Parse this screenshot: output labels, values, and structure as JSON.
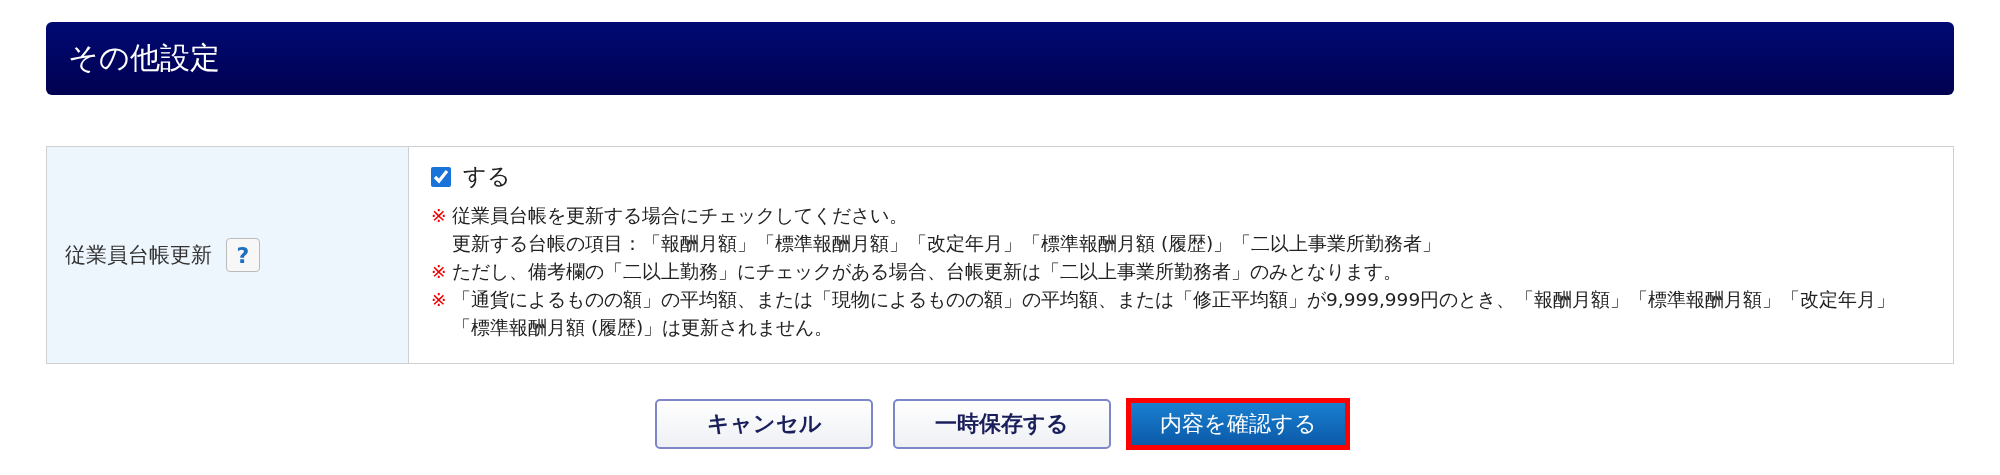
{
  "section_title": "その他設定",
  "setting": {
    "label": "従業員台帳更新",
    "help": "?",
    "checkbox": {
      "label": "する",
      "checked": true
    },
    "notes": [
      {
        "mark": "※",
        "lines": [
          "従業員台帳を更新する場合にチェックしてください。",
          "更新する台帳の項目：「報酬月額」「標準報酬月額」「改定年月」「標準報酬月額 (履歴)」「二以上事業所勤務者」"
        ]
      },
      {
        "mark": "※",
        "lines": [
          "ただし、備考欄の「二以上勤務」にチェックがある場合、台帳更新は「二以上事業所勤務者」のみとなります。"
        ]
      },
      {
        "mark": "※",
        "lines": [
          "「通貨によるものの額」の平均額、または「現物によるものの額」の平均額、または「修正平均額」が9,999,999円のとき、「報酬月額」「標準報酬月額」「改定年月」「標準報酬月額 (履歴)」は更新されません。"
        ]
      }
    ]
  },
  "buttons": [
    {
      "label": "キャンセル",
      "kind": "secondary",
      "highlighted": false
    },
    {
      "label": "一時保存する",
      "kind": "secondary",
      "highlighted": false
    },
    {
      "label": "内容を確認する",
      "kind": "primary",
      "highlighted": true
    }
  ]
}
